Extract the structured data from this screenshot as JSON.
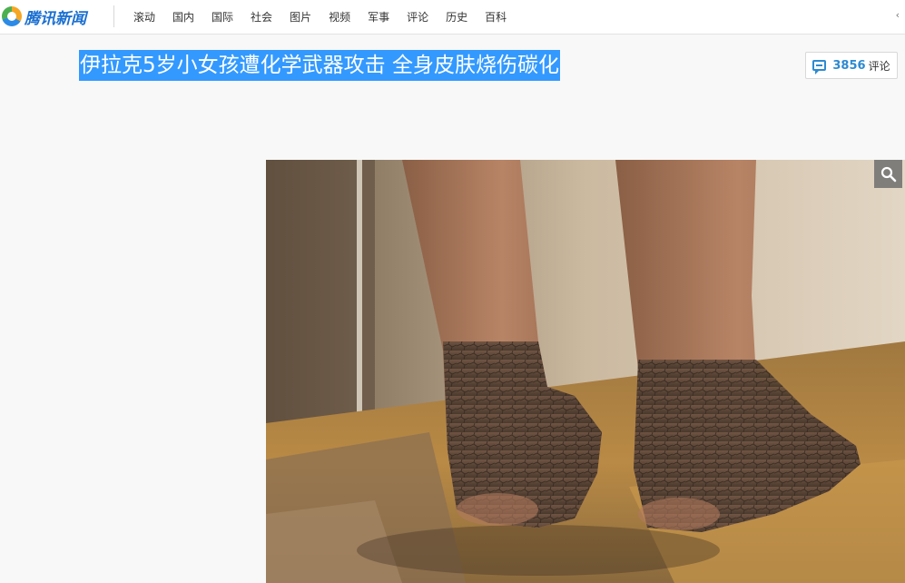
{
  "header": {
    "logo_text": "腾讯新闻",
    "nav": [
      "滚动",
      "国内",
      "国际",
      "社会",
      "图片",
      "视频",
      "军事",
      "评论",
      "历史",
      "百科"
    ],
    "more_glyph": "‹"
  },
  "article": {
    "title": "伊拉克5岁小女孩遭化学武器攻击 全身皮肤烧伤碳化",
    "comments": {
      "count": "3856",
      "label": "评论"
    }
  },
  "photo": {
    "subject": "burned feet on stone floor",
    "zoom_icon": "magnifier-icon"
  },
  "colors": {
    "accent": "#2d8ad1",
    "selection": "#3399ff",
    "brand": "#1a6fd1"
  }
}
